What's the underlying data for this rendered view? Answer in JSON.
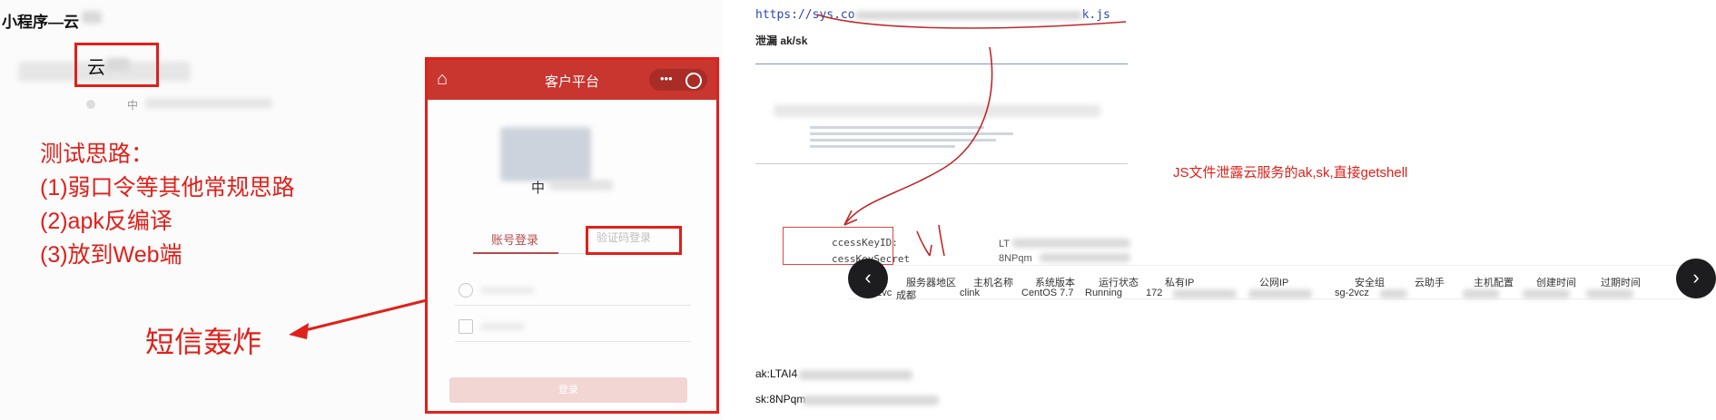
{
  "left": {
    "mini_title": "小程序—云",
    "mini_name": "云",
    "mini_sub": "中",
    "notes": [
      "测试思路：",
      "(1)弱口令等其他常规思路",
      "(2)apk反编译",
      "(3)放到Web端"
    ],
    "sms_bomb_label": "短信轰炸",
    "phone": {
      "title": "客户平台",
      "capsule_dots": "•••",
      "logo_text": "中",
      "tab_account": "账号登录",
      "tab_sms": "验证码登录",
      "login_button": "登录"
    }
  },
  "right": {
    "url": "https://sys.co",
    "url_suffix": "k.js",
    "leak_title": "泄漏 ak/sk",
    "annotation": "JS文件泄露云服务的ak,sk,直接getshell",
    "access_key_label": "ccessKeyID:",
    "access_key_secret_label": "cessKeySecret",
    "access_key_value": "LT",
    "access_key_secret_value": "8NPqm",
    "console": {
      "headers": [
        "服务器地区",
        "主机名称",
        "系统版本",
        "运行状态",
        "私有IP",
        "公网IP",
        "安全组",
        "云助手",
        "主机配置",
        "创建时间",
        "过期时间"
      ],
      "row": {
        "id_prefix": "i-2vc",
        "region": "成都",
        "hostname": "clink",
        "os": "CentOS  7.7",
        "status": "Running",
        "private_ip": "172",
        "security_group": "sg-2vcz"
      },
      "prev_icon": "chevron-left-icon",
      "next_icon": "chevron-right-icon"
    },
    "ak": "ak:LTAI4",
    "sk": "sk:8NPqm"
  },
  "colors": {
    "highlight_red": "#e0201a",
    "app_header": "#c9352f",
    "url_blue": "#2a46b0"
  }
}
